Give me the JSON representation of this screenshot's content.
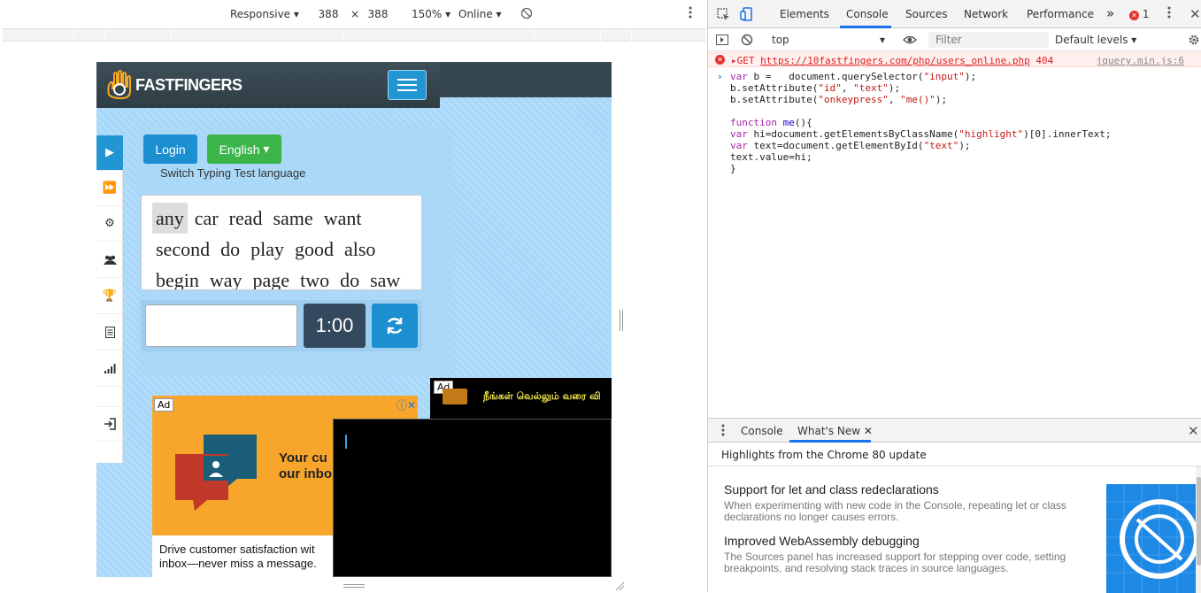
{
  "emulation": {
    "device": "Responsive",
    "width": "388",
    "times": "×",
    "height": "388",
    "zoom": "150%",
    "throttling": "Online"
  },
  "site": {
    "logo_text": "FASTFINGERS",
    "login_label": "Login",
    "language_label": "English",
    "switch_language_text": "Switch Typing Test language",
    "words_line1": [
      "any",
      "car",
      "read",
      "same",
      "want"
    ],
    "words_line2": [
      "second",
      "do",
      "play",
      "good",
      "also"
    ],
    "words_line3": [
      "begin",
      "way",
      "page",
      "two",
      "do",
      "saw"
    ],
    "timer": "1:00",
    "input_value": ""
  },
  "ads": {
    "ad1_badge": "Ad",
    "ad1_controls": "ⓘ✕",
    "ad1_headline_1": "Your cu",
    "ad1_headline_2": "our inbo",
    "ad1_bottom_1": "Drive customer satisfaction wit",
    "ad1_bottom_2": "inbox—never miss a message.",
    "ad2_badge": "Ad",
    "ad2_text": "நீங்கள் வெல்லும் வரை வி"
  },
  "devtools": {
    "tabs": [
      "Elements",
      "Console",
      "Sources",
      "Network",
      "Performance"
    ],
    "more_tabs": "»",
    "error_count": "1",
    "context": "top",
    "filter_placeholder": "Filter",
    "levels": "Default levels ▾",
    "error": {
      "method": "GET",
      "url": "https://10fastfingers.com/php/users_online.php",
      "status": "404",
      "source": "jquery.min.js:6"
    },
    "code_lines": [
      "var b =   document.querySelector(\"input\");",
      "b.setAttribute(\"id\", \"text\");",
      "b.setAttribute(\"onkeypress\", \"me()\");",
      "",
      "function me(){",
      "var hi=document.getElementsByClassName(\"highlight\")[0].innerText;",
      "var text=document.getElementById(\"text\");",
      "text.value=hi;",
      "}"
    ],
    "drawer": {
      "tab_console": "Console",
      "tab_whats_new": "What's New",
      "header": "Highlights from the Chrome 80 update",
      "items": [
        {
          "title": "Support for let and class redeclarations",
          "body": "When experimenting with new code in the Console, repeating let or class declarations no longer causes errors."
        },
        {
          "title": "Improved WebAssembly debugging",
          "body": "The Sources panel has increased support for stepping over code, setting breakpoints, and resolving stack traces in source languages."
        }
      ]
    }
  },
  "colors": {
    "accent": "#1a73e8",
    "login_blue": "#1b8fd0",
    "lang_green": "#3bb54a",
    "timer_dark": "#34495e",
    "ad_orange": "#f8a62b"
  }
}
